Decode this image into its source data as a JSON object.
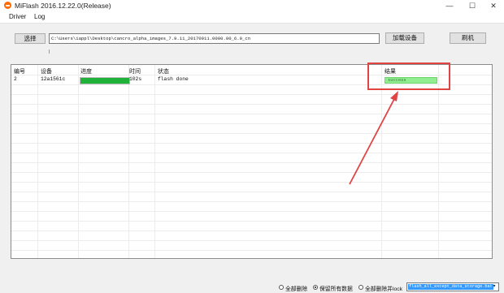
{
  "window": {
    "title": "MiFlash 2016.12.22.0(Release)",
    "minimize_glyph": "—",
    "maximize_glyph": "☐",
    "close_glyph": "✕"
  },
  "menu": {
    "items": [
      "Driver",
      "Log"
    ]
  },
  "toolbar": {
    "select_label": "选择",
    "path_value": "C:\\Users\\iappl\\Desktop\\cancro_alpha_images_7.9.11_20170911.0000.00_6.0_cn",
    "load_device_label": "加载设备",
    "flash_label": "刷机"
  },
  "table": {
    "headers": [
      "编号",
      "设备",
      "进度",
      "时间",
      "状态",
      "结果"
    ],
    "rows": [
      {
        "id": "2",
        "device": "12a1561c",
        "progress": 1.0,
        "time": "102s",
        "status": "flash done",
        "result": "success"
      }
    ]
  },
  "footer": {
    "options": [
      "全部删除",
      "保留所有数据",
      "全部删除并lock"
    ],
    "selected": "保留所有数据",
    "script_value": "flash_all_except_data_storage.bat"
  },
  "colors": {
    "progress_fill": "#20b13a",
    "result_bg": "#90ee90",
    "annotation": "#e04545"
  },
  "icons": {
    "app": "miflash-logo-icon",
    "dropdown": "chevron-down-icon"
  }
}
